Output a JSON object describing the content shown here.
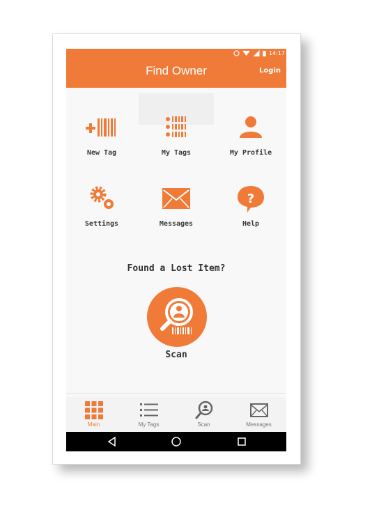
{
  "status": {
    "time": "14:17"
  },
  "header": {
    "title": "Find Owner",
    "login_label": "Login"
  },
  "tiles": [
    {
      "label": "New Tag",
      "icon": "add-barcode-icon"
    },
    {
      "label": "My Tags",
      "icon": "tag-list-icon"
    },
    {
      "label": "My Profile",
      "icon": "person-icon"
    },
    {
      "label": "Settings",
      "icon": "gears-icon"
    },
    {
      "label": "Messages",
      "icon": "envelope-icon"
    },
    {
      "label": "Help",
      "icon": "help-bubble-icon"
    }
  ],
  "found": {
    "prompt": "Found a Lost Item?",
    "scan_label": "Scan"
  },
  "tabs": [
    {
      "label": "Main",
      "icon": "grid-icon",
      "active": true
    },
    {
      "label": "My Tags",
      "icon": "list-icon",
      "active": false
    },
    {
      "label": "Scan",
      "icon": "scan-search-icon",
      "active": false
    },
    {
      "label": "Messages",
      "icon": "envelope-icon",
      "active": false
    }
  ],
  "colors": {
    "accent": "#f07b39",
    "text": "#3a3a3a",
    "nav": "#000000"
  }
}
